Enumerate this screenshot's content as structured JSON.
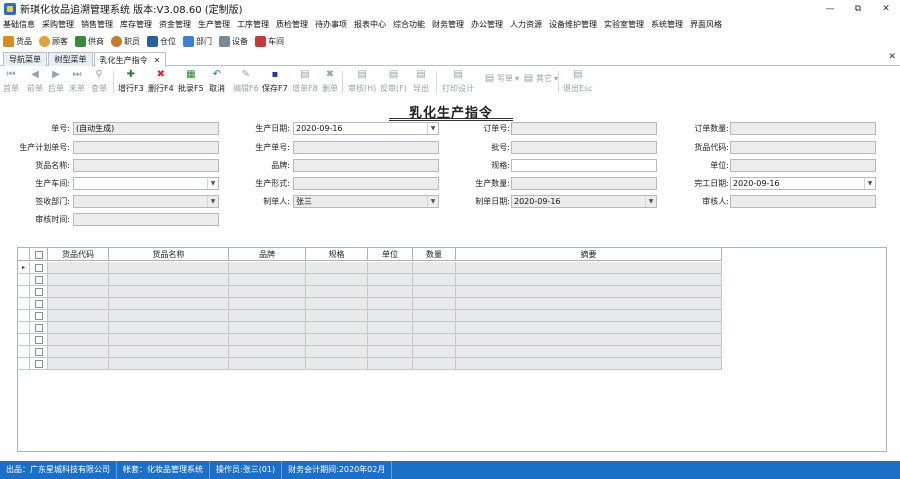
{
  "window": {
    "title": "新琪化妆品追溯管理系统 版本:V3.08.60 (定制版)",
    "minimize": "—",
    "restore": "⧉",
    "close": "✕"
  },
  "menu": [
    "基础信息",
    "采购管理",
    "销售管理",
    "库存管理",
    "资金管理",
    "生产管理",
    "工序管理",
    "质检管理",
    "待办事项",
    "报表中心",
    "综合功能",
    "财务管理",
    "办公管理",
    "人力资源",
    "设备维护管理",
    "实验室管理",
    "系统管理",
    "界面风格"
  ],
  "quickbar": [
    {
      "label": "货品",
      "icon": "goods-icon",
      "color": "#d88a2b"
    },
    {
      "label": "顾客",
      "icon": "customer-icon",
      "color": "#e0a03a"
    },
    {
      "label": "供商",
      "icon": "supplier-icon",
      "color": "#3a8a3a"
    },
    {
      "label": "职员",
      "icon": "staff-icon",
      "color": "#c9782f"
    },
    {
      "label": "仓位",
      "icon": "warehouse-icon",
      "color": "#2a5f9e"
    },
    {
      "label": "部门",
      "icon": "department-icon",
      "color": "#3f7fd1"
    },
    {
      "label": "设备",
      "icon": "device-icon",
      "color": "#7a8a99"
    },
    {
      "label": "车间",
      "icon": "workshop-icon",
      "color": "#c23b3b"
    }
  ],
  "tabs": {
    "nav": "导航菜单",
    "tree": "树型菜单",
    "active": "乳化生产指令",
    "close": "✕",
    "panel_close": "✕"
  },
  "toolbar": {
    "first": "首单",
    "prev": "前单",
    "next": "后单",
    "last": "末单",
    "search": "查单",
    "add_row": "增行F3",
    "del_row": "删行F4",
    "batch_add": "批录F5",
    "undo": "取消",
    "edit": "编辑F6",
    "save": "保存F7",
    "new": "增单F8",
    "delete": "删单",
    "audit": "审核(H)",
    "unaudit": "反审(F)",
    "export": "导出",
    "print_design": "打印设计",
    "print": "写单",
    "other": "其它",
    "exit": "退出Esc"
  },
  "form": {
    "title": "乳化生产指令",
    "labels": {
      "order_no": "单号:",
      "plan_no": "生产计划单号:",
      "product_name": "货品名称:",
      "workshop": "生产车间:",
      "receive_dept": "签收部门:",
      "audit_time": "审核时间:",
      "prod_date": "生产日期:",
      "prod_order_no": "生产单号:",
      "brand": "品牌:",
      "prod_form": "生产形式:",
      "creator": "制单人:",
      "order_num": "订单号:",
      "batch_no": "批号:",
      "spec": "规格:",
      "prod_qty": "生产数量:",
      "create_date": "制单日期:",
      "order_qty": "订单数量:",
      "product_code": "货品代码:",
      "unit": "单位:",
      "finish_date": "完工日期:",
      "auditor": "审核人:"
    },
    "values": {
      "order_no": "(自动生成)",
      "prod_date": "2020-09-16",
      "creator": "张三",
      "create_date": "2020-09-16",
      "finish_date": "2020-09-16"
    }
  },
  "grid": {
    "columns": [
      "货品代码",
      "货品名称",
      "品牌",
      "规格",
      "单位",
      "数量",
      "摘要"
    ],
    "row_marker": "▸"
  },
  "status": {
    "company": "出品：广东星城科技有限公司",
    "account": "帐套：化妆品管理系统",
    "operator": "操作员:张三(01)",
    "period": "财务会计期间:2020年02月"
  }
}
